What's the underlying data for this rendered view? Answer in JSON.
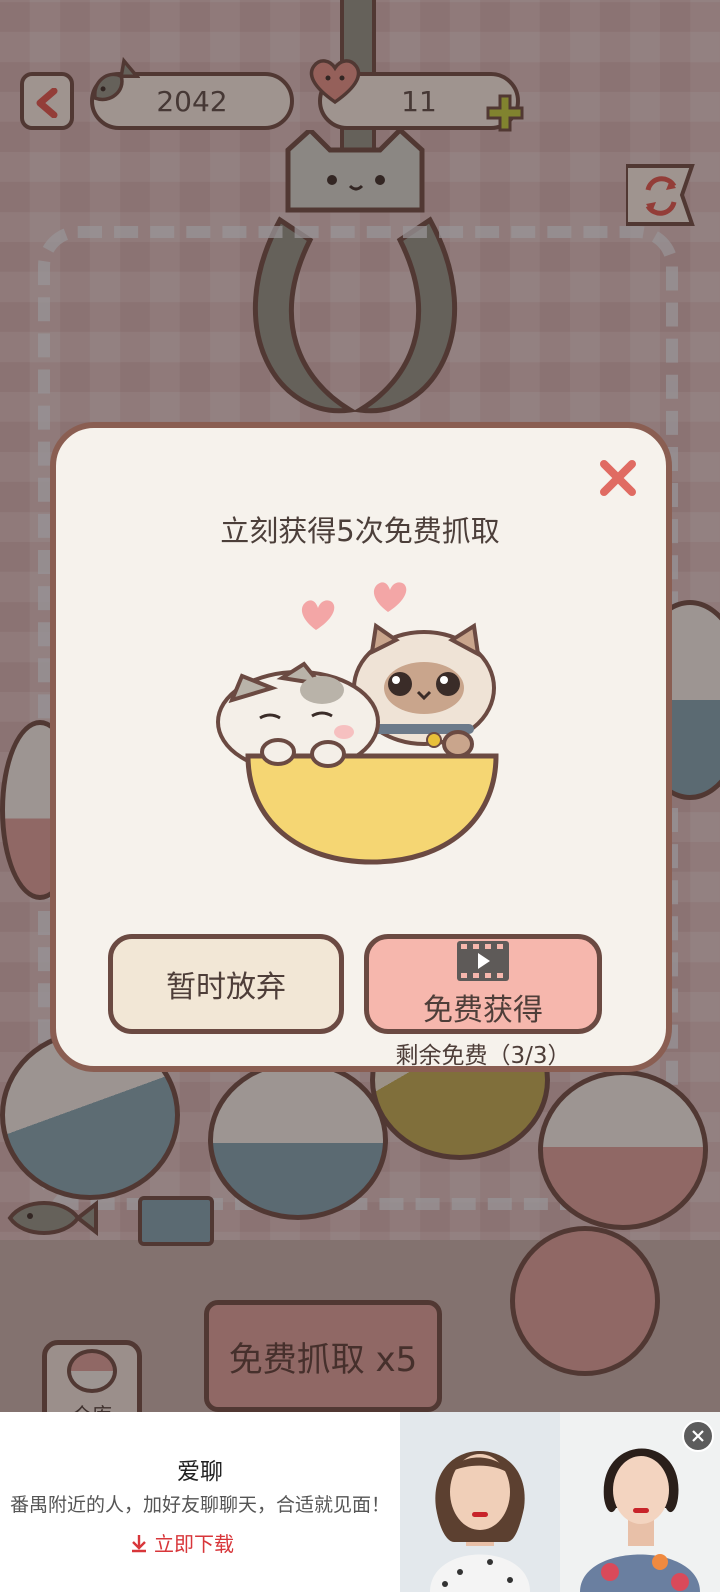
{
  "hud": {
    "fish_count": "2042",
    "heart_count": "11"
  },
  "dialog": {
    "title": "立刻获得5次免费抓取",
    "give_up_label": "暂时放弃",
    "get_free_label": "免费获得",
    "remaining_label": "剩余免费（3/3）"
  },
  "bottom": {
    "grab_button_label": "免费抓取 x5",
    "warehouse_label": "仓库"
  },
  "ad": {
    "title": "爱聊",
    "description": "番禺附近的人，加好友聊聊天，合适就见面！",
    "download_label": "立即下载"
  },
  "colors": {
    "close_x": "#e06b62",
    "get_free_button": "#f6b7ad",
    "give_up_button": "#f2e7d6",
    "ad_download": "#d8363a",
    "outline_brown": "#6b4a42"
  },
  "icons": [
    "back-arrow-icon",
    "fish-icon",
    "heart-icon",
    "plus-icon",
    "refresh-icon",
    "close-icon",
    "video-icon",
    "download-icon",
    "ad-close-icon"
  ]
}
